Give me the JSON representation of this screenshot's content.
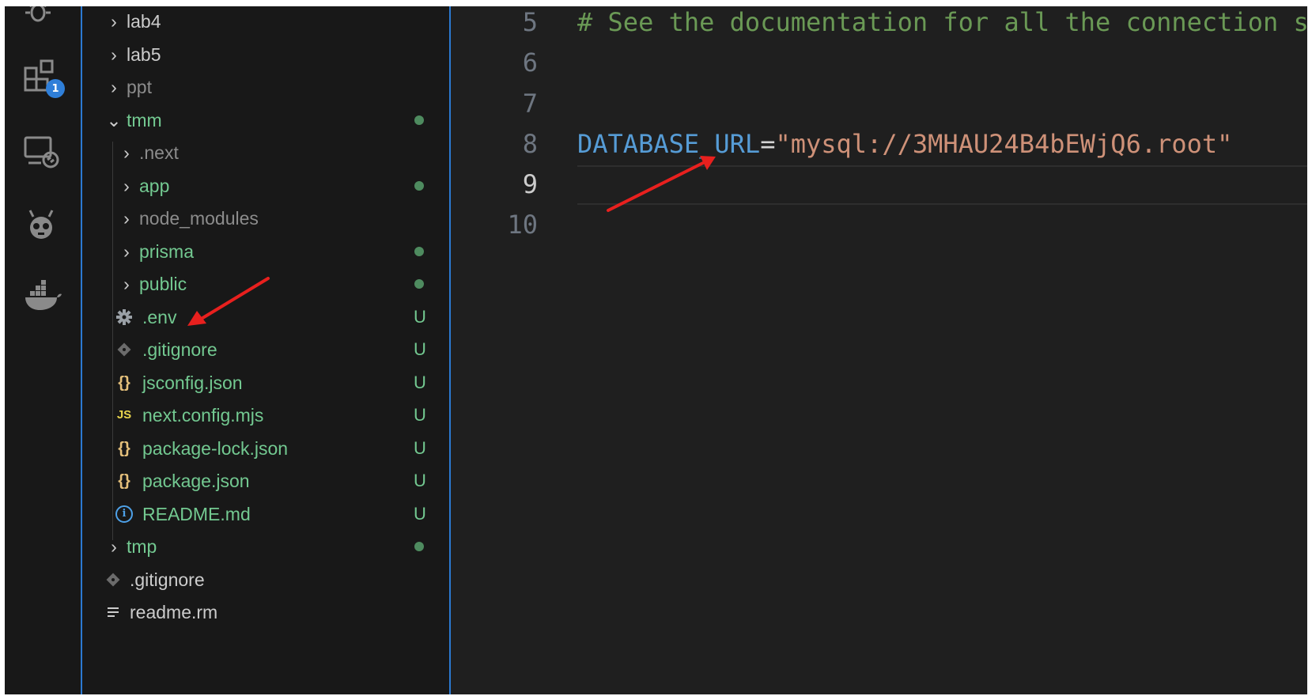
{
  "activity_bar": {
    "icons": [
      "debug-icon",
      "extensions-icon",
      "remote-explorer-icon",
      "platformio-icon",
      "docker-icon"
    ],
    "extensions_badge": "1"
  },
  "explorer": {
    "items": [
      {
        "label": "lab4",
        "color": "#cccccc"
      },
      {
        "label": "lab5",
        "color": "#cccccc"
      },
      {
        "label": "ppt",
        "color": "#8c8c8c"
      },
      {
        "label": "tmm",
        "color": "#73c991"
      },
      {
        "label": ".next",
        "color": "#8c8c8c"
      },
      {
        "label": "app",
        "color": "#73c991"
      },
      {
        "label": "node_modules",
        "color": "#8c8c8c"
      },
      {
        "label": "prisma",
        "color": "#73c991"
      },
      {
        "label": "public",
        "color": "#73c991"
      },
      {
        "label": ".env",
        "color": "#73c991",
        "status": "U",
        "icon": "gear-icon"
      },
      {
        "label": ".gitignore",
        "color": "#73c991",
        "status": "U",
        "icon": "git-icon"
      },
      {
        "label": "jsconfig.json",
        "color": "#73c991",
        "status": "U",
        "icon": "json-icon"
      },
      {
        "label": "next.config.mjs",
        "color": "#73c991",
        "status": "U",
        "icon": "javascript-icon"
      },
      {
        "label": "package-lock.json",
        "color": "#73c991",
        "status": "U",
        "icon": "json-icon"
      },
      {
        "label": "package.json",
        "color": "#73c991",
        "status": "U",
        "icon": "json-icon"
      },
      {
        "label": "README.md",
        "color": "#73c991",
        "status": "U",
        "icon": "info-icon"
      },
      {
        "label": "tmp",
        "color": "#73c991"
      },
      {
        "label": ".gitignore",
        "color": "#cccccc",
        "icon": "git-icon"
      },
      {
        "label": "readme.rm",
        "color": "#cccccc",
        "icon": "text-file-icon"
      }
    ],
    "json_glyph": "{}",
    "js_glyph": "JS",
    "info_glyph": "i"
  },
  "editor": {
    "line_numbers": [
      "5",
      "6",
      "7",
      "8",
      "9",
      "10"
    ],
    "comment": "# See the documentation for all the connection string options",
    "key": "DATABASE_URL",
    "equals": "=",
    "value": "\"mysql://3MHAU24B4bEWjQ6.root\"",
    "current_line": "9",
    "colors": {
      "comment": "#6a9955",
      "key": "#569cd6",
      "operator": "#d4d4d4",
      "string": "#ce9178",
      "line_number": "#6e7681",
      "active_line_number": "#cccccc"
    }
  },
  "annotations": {
    "arrow_color": "#e8201e"
  }
}
